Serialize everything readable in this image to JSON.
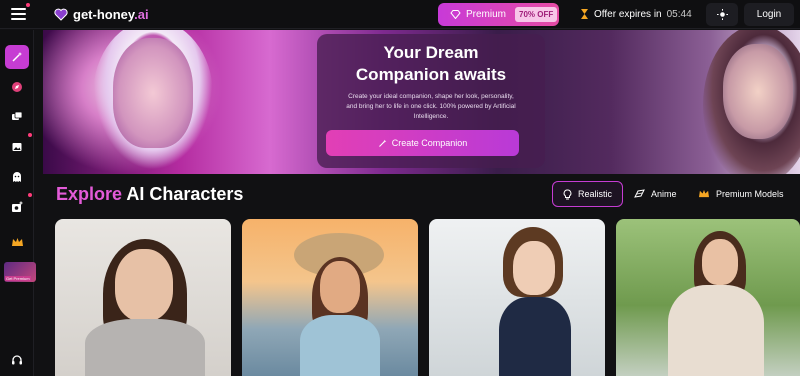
{
  "header": {
    "logo_name": "get-honey",
    "logo_suffix": ".ai",
    "premium_label": "Premium",
    "premium_discount": "70% OFF",
    "offer_label": "Offer expires in",
    "offer_time": "05:44",
    "login_label": "Login"
  },
  "sidebar": {
    "items": [
      {
        "icon": "magic-wand-icon"
      },
      {
        "icon": "compass-icon"
      },
      {
        "icon": "chat-bubbles-icon"
      },
      {
        "icon": "image-gallery-icon"
      },
      {
        "icon": "ghost-icon"
      },
      {
        "icon": "add-photo-icon"
      },
      {
        "icon": "crown-icon"
      }
    ],
    "thumb_label": "Get Premium",
    "bottom_icon": "headset-icon"
  },
  "hero": {
    "title_line1": "Your Dream",
    "title_line2": "Companion awaits",
    "description": "Create your ideal companion, shape her look, personality, and bring her to life in one click. 100% powered by Artificial Intelligence.",
    "cta_label": "Create Companion"
  },
  "explore": {
    "title_accent": "Explore",
    "title_rest": "AI Characters",
    "filters": [
      {
        "label": "Realistic",
        "icon": "lightbulb-icon",
        "active": true
      },
      {
        "label": "Anime",
        "icon": "anime-icon",
        "active": false
      },
      {
        "label": "Premium Models",
        "icon": "crown-icon",
        "active": false
      }
    ]
  },
  "colors": {
    "accent": "#c63cd3",
    "accent_pink": "#e35bd8",
    "background": "#111113"
  }
}
